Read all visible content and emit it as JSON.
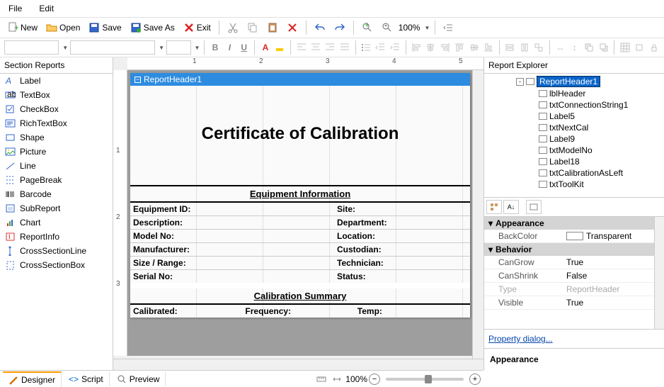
{
  "menu": {
    "file": "File",
    "edit": "Edit"
  },
  "toolbar": {
    "new": "New",
    "open": "Open",
    "save": "Save",
    "saveAs": "Save As",
    "exit": "Exit",
    "zoomValue": "100%"
  },
  "sectionReports": {
    "title": "Section Reports",
    "items": [
      "Label",
      "TextBox",
      "CheckBox",
      "RichTextBox",
      "Shape",
      "Picture",
      "Line",
      "PageBreak",
      "Barcode",
      "SubReport",
      "Chart",
      "ReportInfo",
      "CrossSectionLine",
      "CrossSectionBox"
    ]
  },
  "ruler": {
    "h": [
      "1",
      "2",
      "3",
      "4",
      "5"
    ],
    "v": [
      "1",
      "2",
      "3"
    ]
  },
  "design": {
    "sectionHeader": "ReportHeader1",
    "title": "Certificate of Calibration",
    "equipInfo": "Equipment Information",
    "fields": {
      "equipmentId": "Equipment ID:",
      "site": "Site:",
      "description": "Description:",
      "department": "Department:",
      "modelNo": "Model No:",
      "location": "Location:",
      "manufacturer": "Manufacturer:",
      "custodian": "Custodian:",
      "sizeRange": "Size / Range:",
      "technician": "Technician:",
      "serialNo": "Serial No:",
      "status": "Status:"
    },
    "calSummary": "Calibration Summary",
    "calFields": {
      "calibrated": "Calibrated:",
      "frequency": "Frequency:",
      "temp": "Temp:"
    }
  },
  "reportExplorer": {
    "title": "Report Explorer",
    "nodes": [
      {
        "label": "ReportHeader1",
        "sel": true,
        "depth": 1,
        "exp": "-"
      },
      {
        "label": "lblHeader",
        "depth": 2
      },
      {
        "label": "txtConnectionString1",
        "depth": 2
      },
      {
        "label": "Label5",
        "depth": 2
      },
      {
        "label": "txtNextCal",
        "depth": 2
      },
      {
        "label": "Label9",
        "depth": 2
      },
      {
        "label": "txtModelNo",
        "depth": 2
      },
      {
        "label": "Label18",
        "depth": 2
      },
      {
        "label": "txtCalibrationAsLeft",
        "depth": 2
      },
      {
        "label": "txtToolKit",
        "depth": 2
      }
    ]
  },
  "properties": {
    "cats": {
      "appearance": "Appearance",
      "behavior": "Behavior"
    },
    "rows": {
      "backColor": {
        "name": "BackColor",
        "val": "Transparent"
      },
      "canGrow": {
        "name": "CanGrow",
        "val": "True"
      },
      "canShrink": {
        "name": "CanShrink",
        "val": "False"
      },
      "type": {
        "name": "Type",
        "val": "ReportHeader"
      },
      "visible": {
        "name": "Visible",
        "val": "True"
      }
    },
    "link": "Property dialog...",
    "descTitle": "Appearance"
  },
  "statusbar": {
    "designer": "Designer",
    "script": "Script",
    "preview": "Preview",
    "zoom": "100%"
  }
}
